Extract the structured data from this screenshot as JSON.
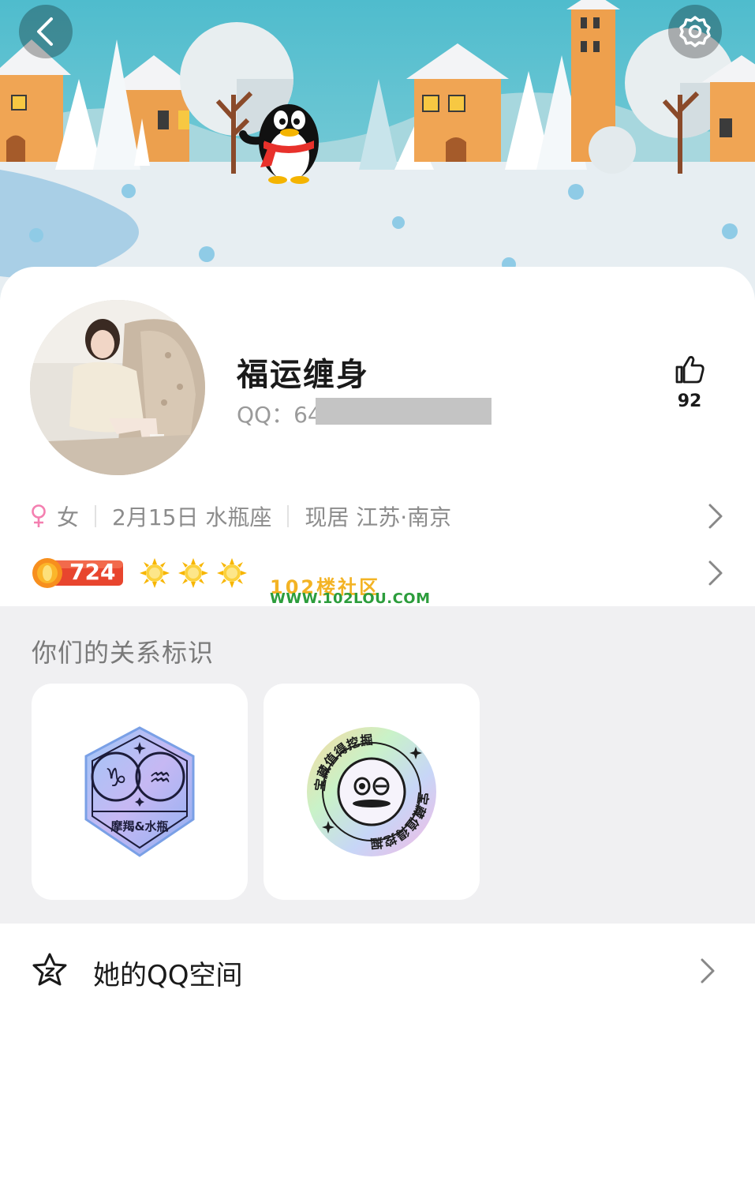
{
  "profile": {
    "nickname": "福运缠身",
    "qq_prefix": "QQ：64",
    "likes": "92"
  },
  "info": {
    "gender": "女",
    "birthday": "2月15日 水瓶座",
    "location": "现居 江苏·南京"
  },
  "level": {
    "value": "724",
    "sun_count": 3
  },
  "watermark": {
    "title": "102楼社区",
    "url": "WWW.102LOU.COM"
  },
  "relation": {
    "title": "你们的关系标识",
    "badges": [
      {
        "label": "摩羯&水瓶"
      },
      {
        "label": "宝藏值得挖掘"
      }
    ]
  },
  "qzone": {
    "label": "她的QQ空间"
  },
  "colors": {
    "sky": "#5ac0d0",
    "house_orange": "#f0a554",
    "gender_pink": "#f47fb0",
    "level_red": "#e8452e",
    "sun_yellow": "#f7b500",
    "section_bg": "#f0f0f2"
  },
  "icons": {
    "back": "chevron-left-icon",
    "settings": "gear-icon",
    "like": "thumbs-up-icon",
    "gender": "female-icon",
    "chevron": "chevron-right-icon",
    "qzone": "star-icon"
  }
}
